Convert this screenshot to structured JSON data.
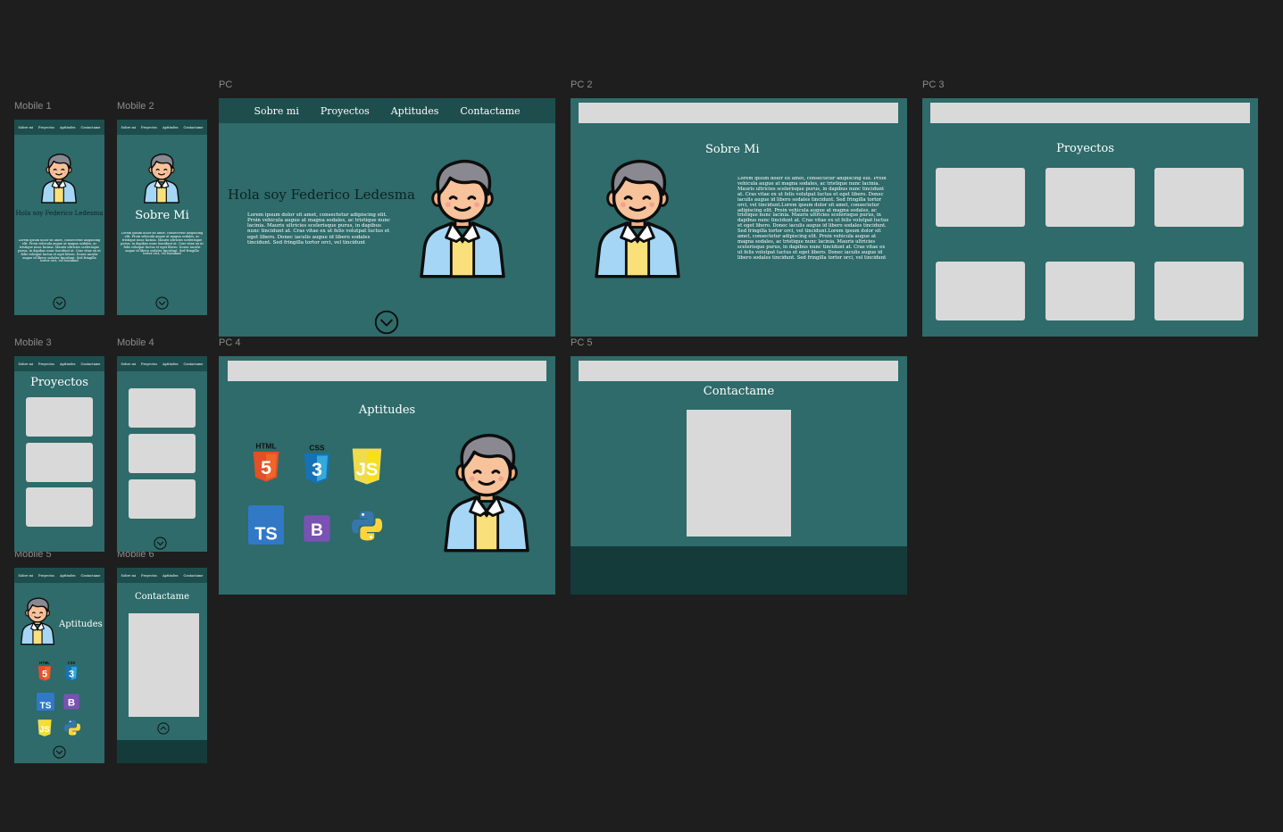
{
  "frames": {
    "mobile1": "Mobile 1",
    "mobile2": "Mobile 2",
    "mobile3": "Mobile 3",
    "mobile4": "Mobile 4",
    "mobile5": "Mobile 5",
    "mobile6": "Mobile 6",
    "pc": "PC",
    "pc2": "PC 2",
    "pc3": "PC 3",
    "pc4": "PC 4",
    "pc5": "PC 5"
  },
  "mobile_nav": [
    "Sobre mi",
    "Proyectos",
    "Aptitudes",
    "Contactame"
  ],
  "pc_nav": [
    "Sobre mi",
    "Proyectos",
    "Aptitudes",
    "Contactame"
  ],
  "hero": {
    "title": "Hola soy Federico Ledesma"
  },
  "about": {
    "title": "Sobre Mi"
  },
  "projects": {
    "title": "Proyectos"
  },
  "skills": {
    "title": "Aptitudes",
    "icons": [
      "html5-icon",
      "css3-icon",
      "javascript-icon",
      "typescript-icon",
      "bootstrap-icon",
      "python-icon"
    ],
    "html_label": "HTML",
    "css_label": "CSS",
    "js_label": "JS",
    "ts_label": "TS",
    "bootstrap_label": "B"
  },
  "contact": {
    "title": "Contactame"
  },
  "lorem": {
    "short": "Lorem ipsum dolor sit amet, consectetur adipiscing elit. Proin vehicula augue at magna sodales, ac tristique nunc lacinia. Mauris ultricies scelerisque purus, in dapibus nunc tincidunt at. Cras vitae ex ut felis volutpat luctus et eget libero. Donec iaculis augue id libero sodales tincidunt. Sed fringilla tortor orci, vel tincidunt",
    "long": "Lorem ipsum dolor sit amet, consectetur adipiscing elit. Proin vehicula augue at magna sodales, ac tristique nunc lacinia. Mauris ultricies scelerisque purus, in dapibus nunc tincidunt at. Cras vitae ex ut felis volutpat luctus et eget libero. Donec iaculis augue id libero sodales tincidunt. Sed fringilla tortor orci, vel tincidunt.Lorem ipsum dolor sit amet, consectetur adipiscing elit. Proin vehicula augue at magna sodales, ac tristique nunc lacinia. Mauris ultricies scelerisque purus, in dapibus nunc tincidunt at. Cras vitae ex ut felis volutpat luctus et eget libero. Donec iaculis augue id libero sodales tincidunt. Sed fringilla tortor orci, vel tincidunt.Lorem ipsum dolor sit amet, consectetur adipiscing elit. Proin vehicula augue at magna sodales, ac tristique nunc lacinia. Mauris ultricies scelerisque purus, in dapibus nunc tincidunt at. Cras vitae ex ut felis volutpat luctus et eget libero. Donec iaculis augue id libero sodales tincidunt. Sed fringilla tortor orci, vel tincidunt"
  },
  "colors": {
    "canvas": "#1e1e1e",
    "frame": "#2e6b6a",
    "navbar": "#1d4e4d",
    "footer": "#143b3a",
    "placeholder": "#d9d9d9"
  }
}
